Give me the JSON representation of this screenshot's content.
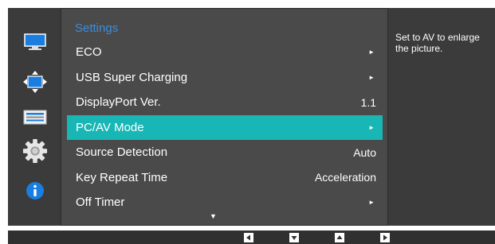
{
  "colors": {
    "accent": "#19b6b6",
    "title": "#3a8dde",
    "panel": "#4a4a4a",
    "background": "#3b3b3b"
  },
  "sidebar": {
    "icons": [
      "picture-icon",
      "position-icon",
      "setup-icon",
      "settings-gear-icon",
      "info-icon"
    ]
  },
  "menu": {
    "title": "Settings",
    "items": [
      {
        "label": "ECO",
        "value": "►",
        "type": "submenu"
      },
      {
        "label": "USB Super Charging",
        "value": "►",
        "type": "submenu"
      },
      {
        "label": "DisplayPort Ver.",
        "value": "1.1",
        "type": "value"
      },
      {
        "label": "PC/AV Mode",
        "value": "►",
        "type": "submenu",
        "selected": true
      },
      {
        "label": "Source Detection",
        "value": "Auto",
        "type": "value"
      },
      {
        "label": "Key Repeat Time",
        "value": "Acceleration",
        "type": "value"
      },
      {
        "label": "Off Timer",
        "value": "►",
        "type": "submenu"
      }
    ],
    "more_indicator": "▼"
  },
  "description": {
    "text": "Set to AV to enlarge the picture."
  },
  "bottom_buttons": [
    "left-arrow-icon",
    "down-arrow-icon",
    "up-arrow-icon",
    "right-arrow-icon"
  ]
}
